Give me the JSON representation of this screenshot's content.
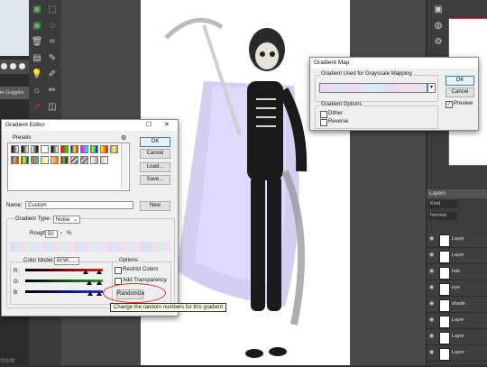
{
  "left_strip": {
    "label": "te Goggles",
    "bottom_text": "添加物"
  },
  "gradient_editor": {
    "title": "Gradient Editor",
    "presets_label": "Presets",
    "gear_icon": "gear-icon",
    "buttons": {
      "ok": "OK",
      "cancel": "Cancel",
      "load": "Load...",
      "save": "Save...",
      "new": "New"
    },
    "name_label": "Name:",
    "name_value": "Custom",
    "gradient_type_label": "Gradient Type:",
    "gradient_type_value": "Noise",
    "roughness_label": "Roughness:",
    "roughness_value": "50",
    "roughness_unit": "%",
    "color_model_label": "Color Model:",
    "color_model_value": "RGB",
    "channels": [
      "R:",
      "G:",
      "B:"
    ],
    "options_label": "Options:",
    "restrict_colors": "Restrict Colors",
    "add_transparency": "Add Transparency",
    "randomize": "Randomize",
    "tooltip": "Change the random numbers for this gradient",
    "colors": {
      "r": "#e02020",
      "g": "#20a020",
      "b": "#2030d0"
    }
  },
  "gradient_map": {
    "title": "Gradient Map",
    "used_label": "Gradient Used for Grayscale Mapping",
    "options_label": "Gradient Options",
    "dither": "Dither",
    "reverse": "Reverse",
    "ok": "OK",
    "cancel": "Cancel",
    "preview": "Preview",
    "preview_checked": true
  },
  "layers_panel": {
    "title": "Layers",
    "kind": "Kind",
    "mode": "Normal",
    "layers": [
      "Layer",
      "Layer",
      "hair",
      "eye",
      "shade",
      "Layer",
      "Layer",
      "Layer"
    ]
  }
}
